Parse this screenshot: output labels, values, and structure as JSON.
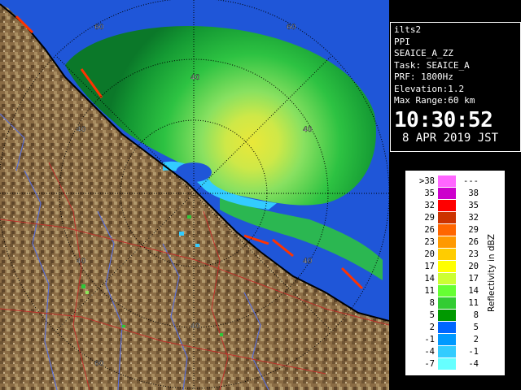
{
  "radar": {
    "site": "ilts2",
    "mode": "PPI",
    "product": "SEAICE_A_ZZ",
    "task": "Task: SEAICE_A",
    "prf": "PRF: 1800Hz",
    "elevation": "Elevation:1.2",
    "max_range": "Max Range:60 km",
    "time": "10:30:52",
    "date": "8 APR 2019 JST"
  },
  "range_labels": [
    "60",
    "40",
    "40",
    "60",
    "40",
    "40",
    "40",
    "40",
    "60"
  ],
  "legend": {
    "units": "Reflectivity in dBZ",
    "rows": [
      {
        "lo": ">38",
        "hi": "---",
        "color": "#ff66ff"
      },
      {
        "lo": "35",
        "hi": "38",
        "color": "#cc00cc"
      },
      {
        "lo": "32",
        "hi": "35",
        "color": "#ff0000"
      },
      {
        "lo": "29",
        "hi": "32",
        "color": "#cc3300"
      },
      {
        "lo": "26",
        "hi": "29",
        "color": "#ff6600"
      },
      {
        "lo": "23",
        "hi": "26",
        "color": "#ff9900"
      },
      {
        "lo": "20",
        "hi": "23",
        "color": "#ffcc00"
      },
      {
        "lo": "17",
        "hi": "20",
        "color": "#ffff00"
      },
      {
        "lo": "14",
        "hi": "17",
        "color": "#ccff33"
      },
      {
        "lo": "11",
        "hi": "14",
        "color": "#66ff33"
      },
      {
        "lo": "8",
        "hi": "11",
        "color": "#33cc33"
      },
      {
        "lo": "5",
        "hi": "8",
        "color": "#009900"
      },
      {
        "lo": "2",
        "hi": "5",
        "color": "#0066ff"
      },
      {
        "lo": "-1",
        "hi": "2",
        "color": "#0099ff"
      },
      {
        "lo": "-4",
        "hi": "-1",
        "color": "#33ccff"
      },
      {
        "lo": "-7",
        "hi": "-4",
        "color": "#66ffff"
      }
    ]
  },
  "colors": {
    "land": "#8a6c45",
    "sea": "#1f56d8",
    "echo_green": "#2ec83a",
    "echo_light": "#8ee85a",
    "echo_yellow": "#f4f030",
    "near_echo": "#33ccff",
    "coast": "#000000",
    "rivers": "#5b6fd6",
    "roads": "#c0302a"
  }
}
